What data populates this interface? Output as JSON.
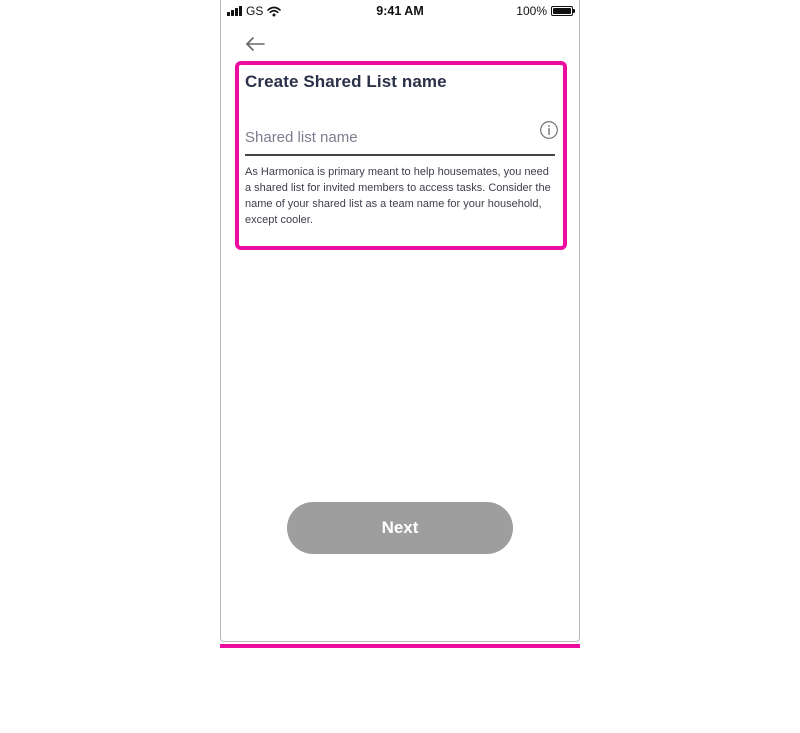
{
  "status_bar": {
    "carrier": "GS",
    "time": "9:41 AM",
    "battery": "100%",
    "icons": [
      "signal-icon",
      "wifi-icon",
      "battery-icon"
    ]
  },
  "nav": {
    "back_icon": "arrow-left-icon"
  },
  "form": {
    "title": "Create Shared List name",
    "input_placeholder": "Shared list name",
    "input_value": "",
    "info_icon": "info-icon",
    "helper_text": "As Harmonica is primary meant to help housemates, you need a shared list for invited members to access tasks. Consider the name of your shared list as a team name for your household, except cooler."
  },
  "actions": {
    "next_label": "Next"
  },
  "colors": {
    "highlight": "#ec0c9f",
    "title": "#2b3148",
    "button_disabled": "#9e9e9e",
    "placeholder": "#7f7c8e"
  }
}
